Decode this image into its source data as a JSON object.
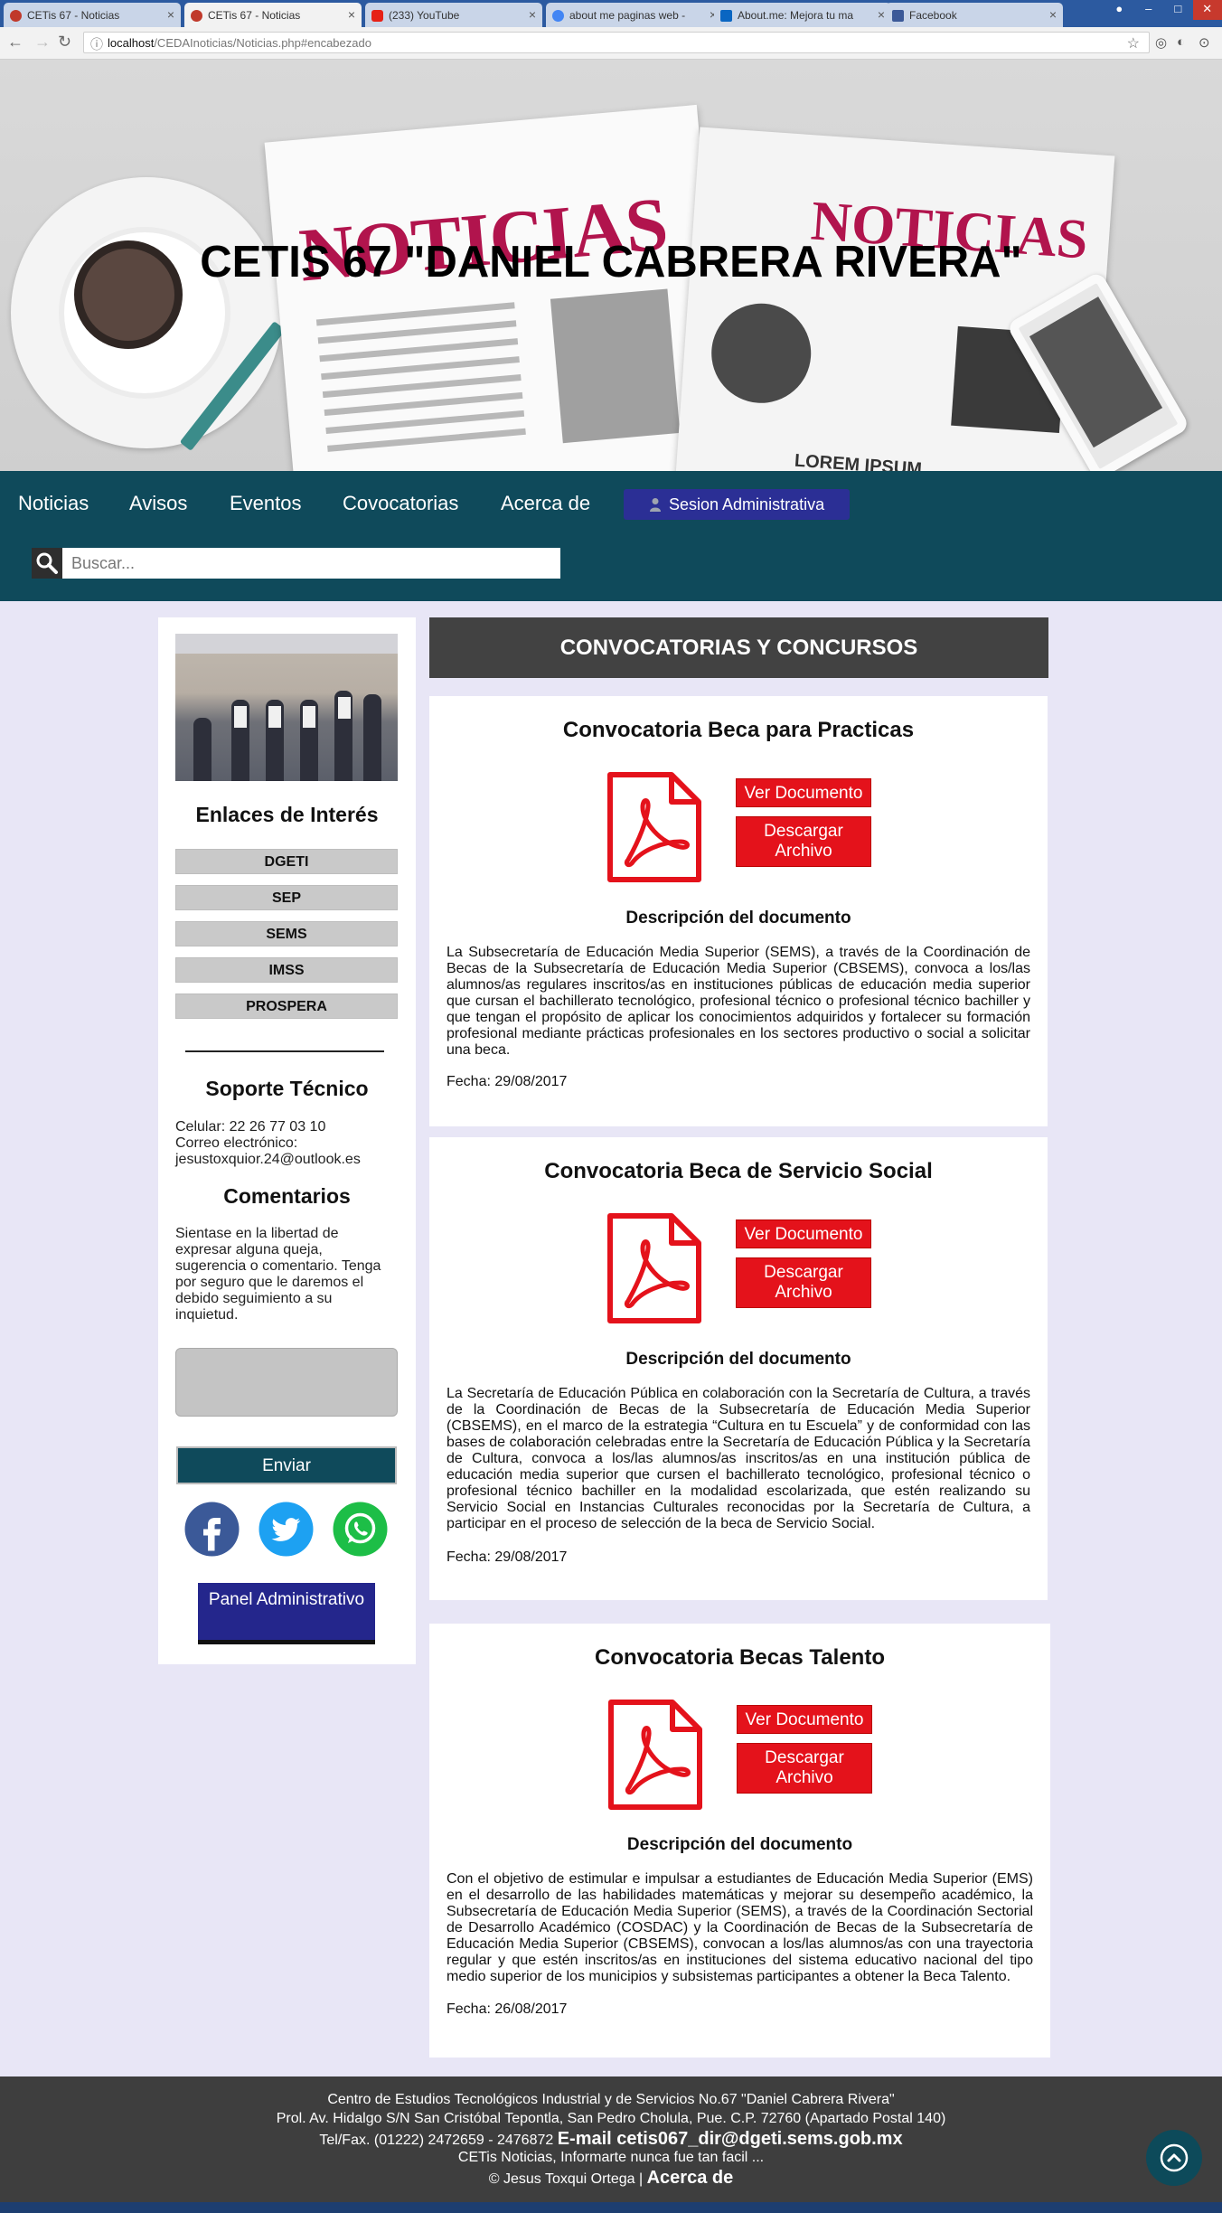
{
  "browser": {
    "tabs": [
      {
        "label": "CETis 67 - Noticias",
        "active": false,
        "fav": "#c0392b"
      },
      {
        "label": "CETis 67 - Noticias",
        "active": true,
        "fav": "#c0392b"
      },
      {
        "label": "(233) YouTube",
        "active": false,
        "fav": "#e62117"
      },
      {
        "label": "about me paginas web -",
        "active": false,
        "fav": "#4285f4"
      },
      {
        "label": "About.me: Mejora tu ma",
        "active": false,
        "fav": "#0a66c2"
      },
      {
        "label": "Facebook",
        "active": false,
        "fav": "#3b5998"
      }
    ],
    "url_host": "localhost",
    "url_path": "/CEDAInoticias/Noticias.php#encabezado"
  },
  "hero": {
    "title": "CETIS 67 \"DANIEL CABRERA RIVERA\"",
    "paper_title": "NOTICIAS",
    "paper_title_2": "NOTICIAS",
    "paper_lorem": "LOREM IPSUM"
  },
  "nav": {
    "items": [
      "Noticias",
      "Avisos",
      "Eventos",
      "Covocatorias",
      "Acerca de"
    ],
    "admin_label": "Sesion Administrativa",
    "search_placeholder": "Buscar..."
  },
  "sidebar": {
    "links_title": "Enlaces de Interés",
    "links": [
      "DGETI",
      "SEP",
      "SEMS",
      "IMSS",
      "PROSPERA"
    ],
    "support_title": "Soporte Técnico",
    "phone": "Celular: 22 26 77 03 10",
    "email_label": "Correo electrónico:",
    "email": "jesustoxquior.24@outlook.es",
    "comments_title": "Comentarios",
    "comments_text": "Sientase en la libertad de expresar alguna queja, sugerencia o comentario. Tenga por seguro que le daremos el debido seguimiento a su inquietud.",
    "send_label": "Enviar",
    "panel_label": "Panel Administrativo"
  },
  "main": {
    "section_title": "CONVOCATORIAS Y CONCURSOS",
    "cards": [
      {
        "title": "Convocatoria Beca para Practicas",
        "view_label": "Ver Documento",
        "download_label": "Descargar Archivo",
        "desc_title": "Descripción del documento",
        "desc": "La Subsecretaría de Educación Media Superior (SEMS), a través de la Coordinación de Becas de la Subsecretaría de Educación Media Superior (CBSEMS), convoca a los/las alumnos/as regulares inscritos/as en instituciones públicas de educación media superior que cursan el bachillerato tecnológico, profesional técnico o profesional técnico bachiller y que tengan el propósito de aplicar los conocimientos adquiridos y fortalecer su formación profesional mediante prácticas profesionales en los sectores productivo o social a solicitar una beca.",
        "fecha": "Fecha: 29/08/2017"
      },
      {
        "title": "Convocatoria Beca de Servicio Social",
        "view_label": "Ver Documento",
        "download_label": "Descargar Archivo",
        "desc_title": "Descripción del documento",
        "desc": "La Secretaría de Educación Pública en colaboración con la Secretaría de Cultura, a través de la Coordinación de Becas de la Subsecretaría de Educación Media Superior (CBSEMS), en el marco de la estrategia “Cultura en tu Escuela” y de conformidad con las bases de colaboración celebradas entre la Secretaría de Educación Pública y la Secretaría de Cultura, convoca a los/las alumnos/as inscritos/as en una institución pública de educación media superior que cursen el bachillerato tecnológico, profesional técnico o profesional técnico bachiller en la modalidad escolarizada, que estén realizando su Servicio Social en Instancias Culturales reconocidas por la Secretaría de Cultura, a participar en el proceso de selección de la beca de Servicio Social.",
        "fecha": "Fecha: 29/08/2017"
      },
      {
        "title": "Convocatoria Becas Talento",
        "view_label": "Ver Documento",
        "download_label": "Descargar Archivo",
        "desc_title": "Descripción del documento",
        "desc": "Con el objetivo de estimular e impulsar a estudiantes de Educación Media Superior (EMS) en el desarrollo de las habilidades matemáticas y mejorar su desempeño académico, la Subsecretaría de Educación Media Superior (SEMS), a través de la Coordinación Sectorial de Desarrollo Académico (COSDAC) y la Coordinación de Becas de la Subsecretaría de Educación Media Superior (CBSEMS), convocan a los/las alumnos/as con una trayectoria regular y que estén inscritos/as en instituciones del sistema educativo nacional del tipo medio superior de los municipios y subsistemas participantes a obtener la Beca Talento.",
        "fecha": "Fecha: 26/08/2017"
      }
    ]
  },
  "footer": {
    "line1": "Centro de Estudios Tecnológicos Industrial y de Servicios No.67 \"Daniel Cabrera Rivera\"",
    "line2": "Prol. Av. Hidalgo S/N San Cristóbal Tepontla, San Pedro Cholula, Pue. C.P. 72760 (Apartado Postal 140)",
    "tel": "Tel/Fax. (01222) 2472659 - 2476872",
    "email": "E-mail cetis067_dir@dgeti.sems.gob.mx",
    "slogan": "CETis Noticias, Informarte nunca fue tan facil ...",
    "copyright": "© Jesus Toxqui Ortega |",
    "about": "Acerca de"
  },
  "colors": {
    "nav_bg": "#0f4a5b",
    "admin_btn": "#2b2f95",
    "pdf_red": "#e4121b",
    "page_bg": "#e8e6f6",
    "footer_bg": "#3e3e3e"
  }
}
